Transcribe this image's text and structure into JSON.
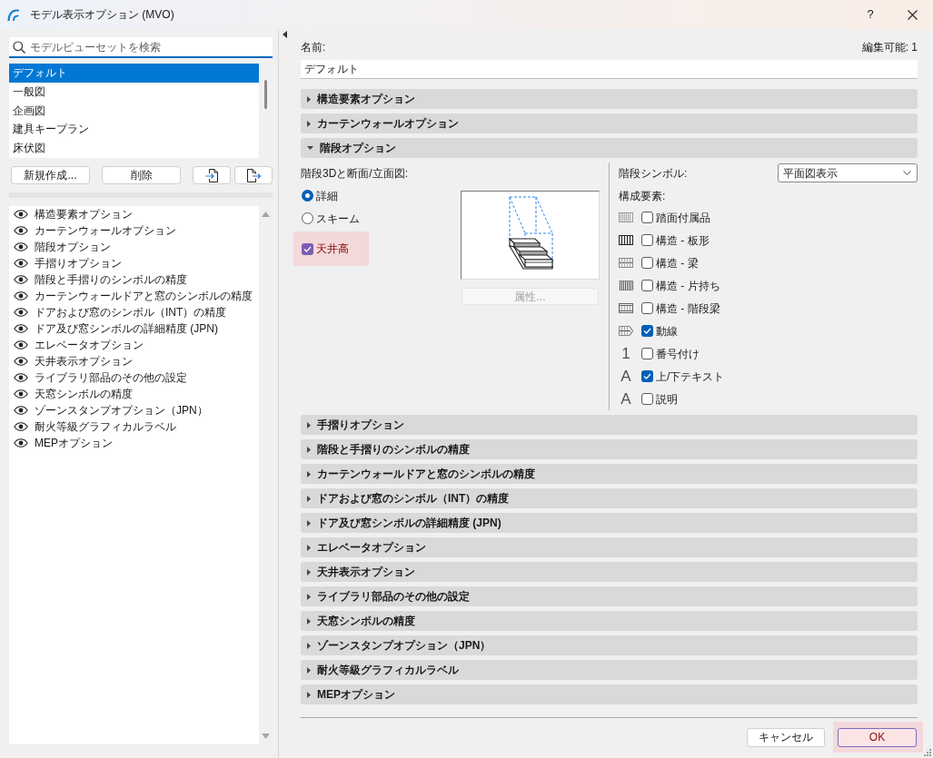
{
  "window": {
    "title": "モデル表示オプション (MVO)",
    "help": "?"
  },
  "search": {
    "placeholder": "モデルビューセットを検索"
  },
  "presets": [
    {
      "label": "デフォルト",
      "selected": true
    },
    {
      "label": "一般図",
      "selected": false
    },
    {
      "label": "企画図",
      "selected": false
    },
    {
      "label": "建具キープラン",
      "selected": false
    },
    {
      "label": "床伏図",
      "selected": false
    }
  ],
  "preset_buttons": [
    {
      "kind": "text",
      "label": "新規作成..."
    },
    {
      "kind": "text",
      "label": "削除"
    },
    {
      "kind": "import"
    },
    {
      "kind": "export"
    }
  ],
  "option_list": [
    "構造要素オプション",
    "カーテンウォールオプション",
    "階段オプション",
    "手摺りオプション",
    "階段と手摺りのシンボルの精度",
    "カーテンウォールドアと窓のシンボルの精度",
    "ドアおよび窓のシンボル（INT）の精度",
    "ドア及び窓シンボルの詳細精度 (JPN)",
    "エレベータオプション",
    "天井表示オプション",
    "ライブラリ部品のその他の設定",
    "天窓シンボルの精度",
    "ゾーンスタンプオプション（JPN）",
    "耐火等級グラフィカルラベル",
    "MEPオプション"
  ],
  "name": {
    "label": "名前:",
    "value": "デフォルト",
    "editable": "編集可能: 1"
  },
  "sections": [
    {
      "title": "構造要素オプション",
      "expanded": false
    },
    {
      "title": "カーテンウォールオプション",
      "expanded": false
    },
    {
      "title": "階段オプション",
      "expanded": true,
      "content": {
        "view_label": "階段3Dと断面/立面図:",
        "modes": [
          {
            "label": "詳細",
            "selected": true
          },
          {
            "label": "スキーム",
            "selected": false
          }
        ],
        "ceiling": {
          "label": "天井高",
          "checked": true,
          "highlighted": true
        },
        "attributes_button": {
          "label": "属性...",
          "disabled": true
        },
        "symbol_label": "階段シンボル:",
        "symbol_value": "平面図表示",
        "components_label": "構成要素:",
        "components": [
          {
            "label": "踏面付属品",
            "checked": false,
            "kind": "pattern"
          },
          {
            "label": "構造 - 板形",
            "checked": false,
            "kind": "pattern"
          },
          {
            "label": "構造 - 梁",
            "checked": false,
            "kind": "pattern"
          },
          {
            "label": "構造 - 片持ち",
            "checked": false,
            "kind": "pattern"
          },
          {
            "label": "構造 - 階段梁",
            "checked": false,
            "kind": "pattern"
          },
          {
            "label": "動線",
            "checked": true,
            "kind": "pattern"
          },
          {
            "label": "番号付け",
            "checked": false,
            "kind": "glyph",
            "glyph": "1"
          },
          {
            "label": "上/下テキスト",
            "checked": true,
            "kind": "glyph",
            "glyph": "A"
          },
          {
            "label": "説明",
            "checked": false,
            "kind": "glyph",
            "glyph": "A"
          }
        ]
      }
    },
    {
      "title": "手摺りオプション",
      "expanded": false
    },
    {
      "title": "階段と手摺りのシンボルの精度",
      "expanded": false
    },
    {
      "title": "カーテンウォールドアと窓のシンボルの精度",
      "expanded": false
    },
    {
      "title": "ドアおよび窓のシンボル（INT）の精度",
      "expanded": false
    },
    {
      "title": "ドア及び窓シンボルの詳細精度 (JPN)",
      "expanded": false
    },
    {
      "title": "エレベータオプション",
      "expanded": false
    },
    {
      "title": "天井表示オプション",
      "expanded": false
    },
    {
      "title": "ライブラリ部品のその他の設定",
      "expanded": false
    },
    {
      "title": "天窓シンボルの精度",
      "expanded": false
    },
    {
      "title": "ゾーンスタンプオプション（JPN）",
      "expanded": false
    },
    {
      "title": "耐火等級グラフィカルラベル",
      "expanded": false
    },
    {
      "title": "MEPオプション",
      "expanded": false
    }
  ],
  "footer": {
    "buttons": [
      {
        "label": "キャンセル",
        "highlighted": false
      },
      {
        "label": "OK",
        "highlighted": true
      }
    ]
  }
}
